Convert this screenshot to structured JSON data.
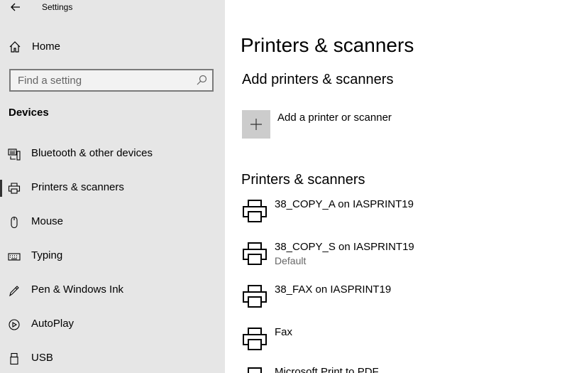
{
  "window": {
    "title": "Settings"
  },
  "sidebar": {
    "home_label": "Home",
    "search_placeholder": "Find a setting",
    "section_title": "Devices",
    "items": [
      {
        "label": "Bluetooth & other devices",
        "icon": "bluetooth-devices-icon"
      },
      {
        "label": "Printers & scanners",
        "icon": "printer-icon",
        "selected": true
      },
      {
        "label": "Mouse",
        "icon": "mouse-icon"
      },
      {
        "label": "Typing",
        "icon": "keyboard-icon"
      },
      {
        "label": "Pen & Windows Ink",
        "icon": "pen-icon"
      },
      {
        "label": "AutoPlay",
        "icon": "autoplay-icon"
      },
      {
        "label": "USB",
        "icon": "usb-icon"
      }
    ]
  },
  "main": {
    "page_title": "Printers & scanners",
    "add_section_title": "Add printers & scanners",
    "add_label": "Add a printer or scanner",
    "list_title": "Printers & scanners",
    "printers": [
      {
        "name": "38_COPY_A on IASPRINT19",
        "status": ""
      },
      {
        "name": "38_COPY_S on IASPRINT19",
        "status": "Default"
      },
      {
        "name": "38_FAX on IASPRINT19",
        "status": ""
      },
      {
        "name": "Fax",
        "status": ""
      },
      {
        "name": "Microsoft Print to PDF",
        "status": ""
      }
    ]
  }
}
